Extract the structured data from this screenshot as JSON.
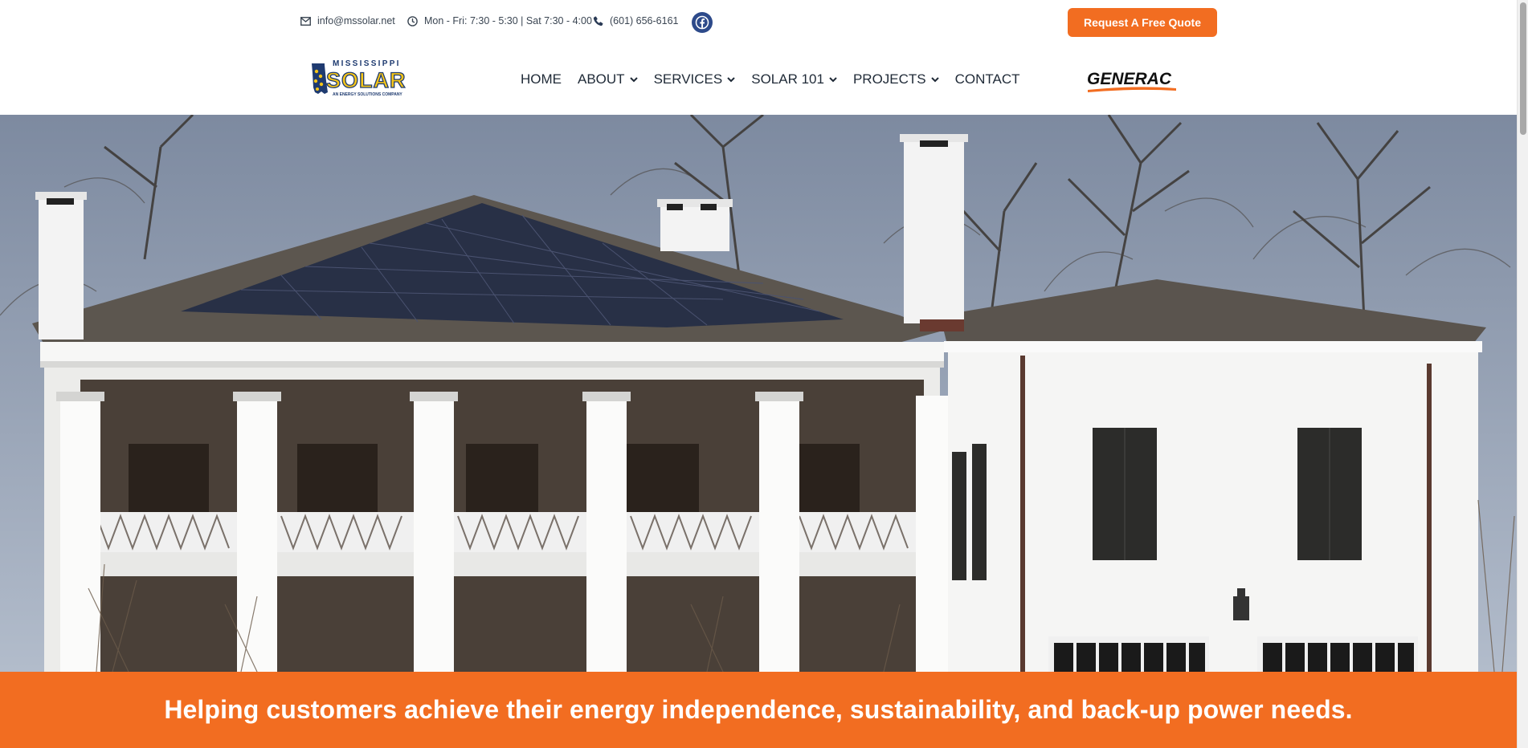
{
  "topbar": {
    "email": "info@mssolar.net",
    "hours": "Mon - Fri: 7:30 - 5:30 | Sat 7:30 - 4:00",
    "phone": "(601) 656-6161",
    "quote_button": "Request A Free Quote",
    "icons": [
      "envelope-icon",
      "clock-icon",
      "phone-icon",
      "facebook-icon"
    ]
  },
  "logo": {
    "line1": "MISSISSIPPI",
    "line2": "SOLAR",
    "tagline": "AN ENERGY SOLUTIONS COMPANY"
  },
  "nav": {
    "items": [
      {
        "label": "HOME",
        "dropdown": false
      },
      {
        "label": "ABOUT",
        "dropdown": true
      },
      {
        "label": "SERVICES",
        "dropdown": true
      },
      {
        "label": "SOLAR 101",
        "dropdown": true
      },
      {
        "label": "PROJECTS",
        "dropdown": true
      },
      {
        "label": "CONTACT",
        "dropdown": false
      }
    ]
  },
  "partner": {
    "name": "GENERAC"
  },
  "hero": {
    "alt": "White house with solar panels on roof"
  },
  "banner": {
    "text": "Helping customers achieve their energy independence, sustainability, and back-up power needs."
  },
  "colors": {
    "accent": "#f26d21",
    "navy": "#1f3b70",
    "text": "#1f2a37"
  }
}
